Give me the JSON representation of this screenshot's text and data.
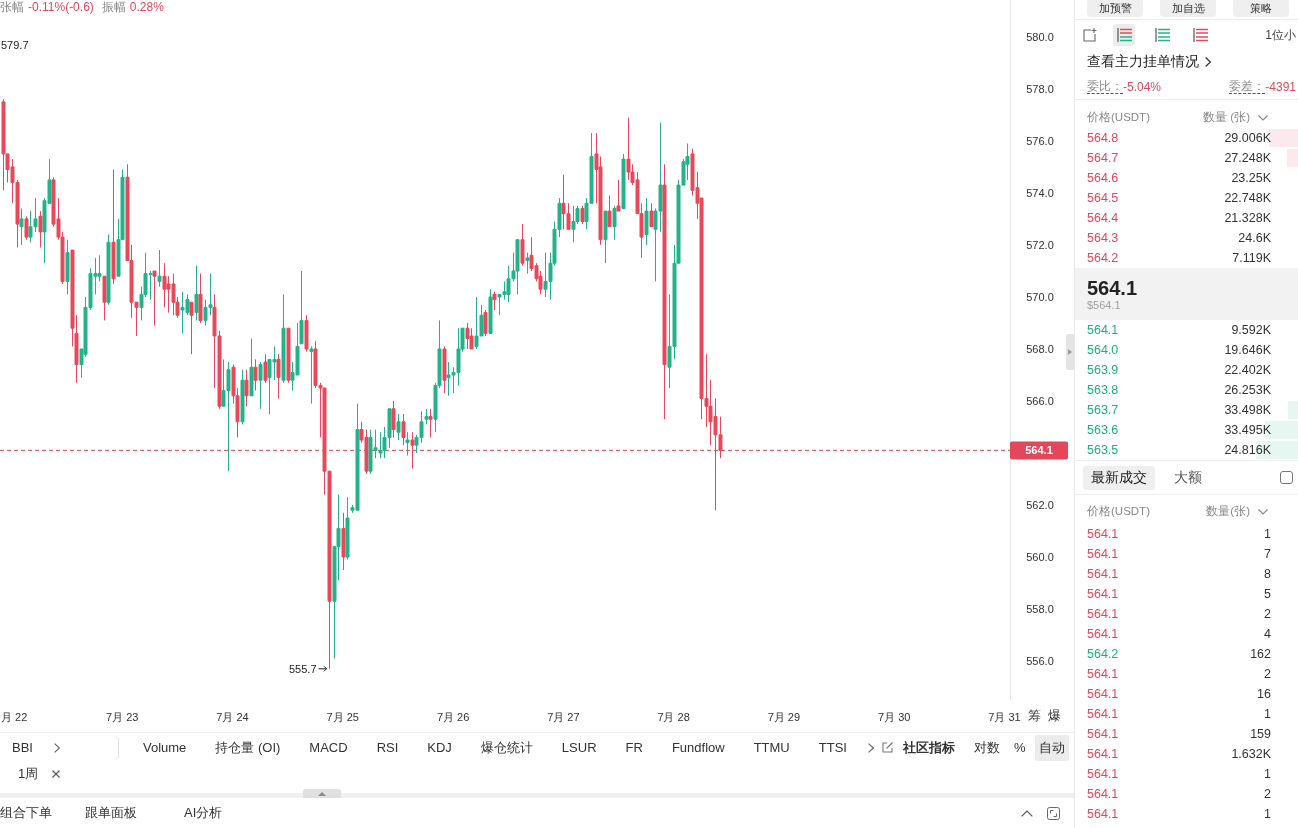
{
  "header": {
    "stats": [
      {
        "label": "张幅",
        "value": "-0.11%(-0.6)"
      },
      {
        "label": "振幅",
        "value": "0.28%"
      }
    ]
  },
  "chart": {
    "chart_data": [
      {
        "type": "candlestick",
        "x": [
          "--07-21T22:00",
          "--07-21T23:00",
          "--07-22T00:00",
          "--07-22T01:00",
          "--07-22T02:00",
          "--07-22T03:00",
          "--07-22T04:00",
          "--07-22T05:00",
          "--07-22T06:00",
          "--07-22T07:00",
          "--07-22T08:00",
          "--07-22T09:00",
          "--07-22T10:00",
          "--07-22T11:00",
          "--07-22T12:00",
          "--07-22T13:00",
          "--07-22T14:00",
          "--07-22T15:00",
          "--07-22T16:00",
          "--07-22T17:00",
          "--07-22T18:00",
          "--07-22T19:00",
          "--07-22T20:00",
          "--07-22T21:00",
          "--07-22T22:00",
          "--07-22T23:00",
          "--07-23T00:00",
          "--07-23T01:00",
          "--07-23T02:00",
          "--07-23T03:00",
          "--07-23T04:00",
          "--07-23T05:00",
          "--07-23T06:00",
          "--07-23T07:00",
          "--07-23T08:00",
          "--07-23T09:00",
          "--07-23T10:00",
          "--07-23T11:00",
          "--07-23T12:00",
          "--07-23T13:00",
          "--07-23T14:00",
          "--07-23T15:00",
          "--07-23T16:00",
          "--07-23T17:00",
          "--07-23T18:00",
          "--07-23T19:00",
          "--07-23T20:00",
          "--07-23T21:00",
          "--07-23T22:00",
          "--07-23T23:00",
          "--07-24T00:00",
          "--07-24T01:00",
          "--07-24T02:00",
          "--07-24T03:00",
          "--07-24T04:00",
          "--07-24T05:00",
          "--07-24T06:00",
          "--07-24T07:00",
          "--07-24T08:00",
          "--07-24T09:00",
          "--07-24T10:00",
          "--07-24T11:00",
          "--07-24T12:00",
          "--07-24T13:00",
          "--07-24T14:00",
          "--07-24T15:00",
          "--07-24T16:00",
          "--07-24T17:00",
          "--07-24T18:00",
          "--07-24T19:00",
          "--07-24T20:00",
          "--07-24T21:00",
          "--07-24T22:00",
          "--07-24T23:00",
          "--07-25T00:00",
          "--07-25T01:00",
          "--07-25T02:00",
          "--07-25T03:00",
          "--07-25T04:00",
          "--07-25T05:00",
          "--07-25T06:00",
          "--07-25T07:00",
          "--07-25T08:00",
          "--07-25T09:00",
          "--07-25T10:00",
          "--07-25T11:00",
          "--07-25T12:00",
          "--07-25T13:00",
          "--07-25T14:00",
          "--07-25T15:00",
          "--07-25T16:00",
          "--07-25T17:00",
          "--07-25T18:00",
          "--07-25T19:00",
          "--07-25T20:00",
          "--07-25T21:00",
          "--07-25T22:00",
          "--07-25T23:00",
          "--07-26T00:00",
          "--07-26T01:00",
          "--07-26T02:00",
          "--07-26T03:00",
          "--07-26T04:00",
          "--07-26T05:00",
          "--07-26T06:00",
          "--07-26T07:00",
          "--07-26T08:00",
          "--07-26T09:00",
          "--07-26T10:00",
          "--07-26T11:00",
          "--07-26T12:00",
          "--07-26T13:00",
          "--07-26T14:00",
          "--07-26T15:00",
          "--07-26T16:00",
          "--07-26T17:00",
          "--07-26T18:00",
          "--07-26T19:00",
          "--07-26T20:00",
          "--07-26T21:00",
          "--07-26T22:00",
          "--07-26T23:00",
          "--07-27T00:00",
          "--07-27T01:00",
          "--07-27T02:00",
          "--07-27T03:00",
          "--07-27T04:00",
          "--07-27T05:00",
          "--07-27T06:00",
          "--07-27T07:00",
          "--07-27T08:00",
          "--07-27T09:00",
          "--07-27T10:00",
          "--07-27T11:00",
          "--07-27T12:00",
          "--07-27T13:00",
          "--07-27T14:00",
          "--07-27T15:00",
          "--07-27T16:00",
          "--07-27T17:00",
          "--07-27T18:00",
          "--07-27T19:00",
          "--07-27T20:00",
          "--07-27T21:00",
          "--07-27T22:00",
          "--07-27T23:00",
          "--07-28T00:00",
          "--07-28T01:00",
          "--07-28T02:00",
          "--07-28T03:00",
          "--07-28T04:00",
          "--07-28T05:00",
          "--07-28T06:00",
          "--07-28T07:00",
          "--07-28T08:00",
          "--07-28T09:00",
          "--07-28T10:00"
        ],
        "ohlc": [
          [
            577.5,
            577.6,
            574.1,
            575.5
          ],
          [
            575.5,
            575.5,
            574.4,
            574.9
          ],
          [
            575.0,
            575.3,
            573.6,
            574.4
          ],
          [
            574.4,
            574.5,
            571.9,
            572.8
          ],
          [
            572.7,
            573.4,
            572.0,
            573.0
          ],
          [
            573.0,
            573.1,
            572.2,
            572.3
          ],
          [
            572.3,
            573.3,
            572.1,
            572.7
          ],
          [
            572.7,
            573.8,
            572.5,
            573.0
          ],
          [
            573.1,
            573.3,
            571.9,
            572.5
          ],
          [
            572.5,
            573.8,
            571.3,
            573.7
          ],
          [
            573.6,
            575.3,
            573.6,
            574.5
          ],
          [
            574.5,
            574.6,
            572.7,
            572.8
          ],
          [
            573.0,
            573.8,
            572.2,
            572.3
          ],
          [
            572.3,
            572.5,
            570.5,
            570.6
          ],
          [
            570.6,
            572.2,
            570.1,
            571.7
          ],
          [
            571.8,
            571.8,
            568.1,
            568.8
          ],
          [
            568.6,
            569.3,
            566.7,
            567.4
          ],
          [
            567.4,
            568.0,
            566.9,
            568.0
          ],
          [
            567.8,
            570.0,
            567.7,
            569.6
          ],
          [
            569.6,
            571.1,
            569.5,
            570.9
          ],
          [
            570.8,
            571.5,
            570.1,
            570.9
          ],
          [
            570.8,
            571.6,
            570.6,
            570.9
          ],
          [
            570.8,
            570.8,
            569.1,
            569.8
          ],
          [
            569.8,
            572.4,
            569.7,
            572.1
          ],
          [
            572.1,
            574.9,
            570.5,
            570.7
          ],
          [
            570.8,
            573.0,
            570.8,
            572.2
          ],
          [
            572.2,
            574.9,
            572.2,
            574.6
          ],
          [
            574.6,
            575.1,
            571.4,
            571.4
          ],
          [
            571.4,
            572.0,
            569.2,
            569.8
          ],
          [
            569.8,
            569.8,
            568.5,
            569.6
          ],
          [
            569.6,
            570.4,
            569.1,
            570.1
          ],
          [
            570.1,
            571.7,
            570.0,
            570.9
          ],
          [
            570.9,
            571.0,
            569.9,
            570.9
          ],
          [
            571.0,
            571.0,
            568.9,
            570.8
          ],
          [
            570.6,
            571.8,
            570.4,
            570.8
          ],
          [
            570.8,
            571.3,
            569.6,
            570.3
          ],
          [
            570.5,
            570.8,
            569.4,
            570.3
          ],
          [
            570.5,
            570.9,
            569.3,
            569.8
          ],
          [
            569.8,
            570.0,
            569.2,
            569.3
          ],
          [
            569.5,
            570.2,
            568.6,
            569.6
          ],
          [
            569.4,
            570.1,
            569.3,
            569.9
          ],
          [
            569.8,
            569.8,
            567.8,
            569.3
          ],
          [
            569.4,
            571.2,
            569.1,
            570.1
          ],
          [
            570.1,
            570.9,
            569.0,
            569.1
          ],
          [
            569.1,
            569.9,
            568.9,
            569.6
          ],
          [
            569.6,
            570.9,
            569.3,
            569.7
          ],
          [
            569.6,
            570.1,
            566.5,
            568.5
          ],
          [
            568.5,
            568.7,
            565.7,
            565.8
          ],
          [
            565.8,
            567.6,
            565.8,
            566.4
          ],
          [
            566.4,
            567.5,
            563.3,
            567.2
          ],
          [
            567.3,
            567.4,
            565.9,
            566.2
          ],
          [
            566.2,
            566.5,
            564.6,
            565.2
          ],
          [
            565.2,
            567.2,
            565.1,
            566.8
          ],
          [
            566.8,
            567.2,
            565.8,
            566.2
          ],
          [
            566.2,
            568.4,
            566.2,
            567.3
          ],
          [
            567.3,
            567.6,
            566.4,
            566.8
          ],
          [
            566.8,
            567.5,
            565.7,
            567.4
          ],
          [
            567.5,
            567.8,
            566.7,
            566.8
          ],
          [
            566.9,
            567.6,
            565.5,
            567.6
          ],
          [
            567.5,
            568.1,
            566.8,
            567.6
          ],
          [
            567.6,
            567.8,
            566.1,
            566.9
          ],
          [
            566.8,
            570.1,
            566.7,
            568.8
          ],
          [
            568.8,
            568.8,
            566.7,
            566.8
          ],
          [
            566.8,
            567.5,
            566.4,
            567.1
          ],
          [
            567.0,
            569.0,
            567.0,
            568.1
          ],
          [
            568.2,
            571.0,
            568.2,
            569.1
          ],
          [
            569.1,
            569.3,
            567.9,
            568.0
          ],
          [
            567.9,
            568.1,
            565.9,
            568.0
          ],
          [
            568.0,
            568.3,
            566.5,
            566.6
          ],
          [
            566.6,
            566.7,
            564.6,
            566.5
          ],
          [
            566.5,
            566.5,
            562.4,
            563.3
          ],
          [
            563.3,
            563.3,
            555.7,
            558.3
          ],
          [
            558.3,
            560.4,
            556.1,
            560.4
          ],
          [
            560.4,
            562.4,
            559.1,
            561.1
          ],
          [
            561.1,
            561.7,
            559.5,
            560.0
          ],
          [
            560.0,
            562.3,
            559.9,
            561.5
          ],
          [
            561.8,
            562.0,
            561.7,
            561.9
          ],
          [
            561.8,
            565.9,
            561.8,
            564.9
          ],
          [
            564.9,
            565.2,
            564.4,
            564.5
          ],
          [
            564.6,
            564.9,
            563.2,
            563.3
          ],
          [
            563.3,
            564.9,
            563.2,
            564.6
          ],
          [
            564.1,
            564.9,
            563.8,
            564.2
          ],
          [
            564.0,
            564.8,
            563.8,
            564.1
          ],
          [
            564.1,
            565.0,
            563.8,
            564.6
          ],
          [
            564.6,
            565.7,
            564.2,
            565.7
          ],
          [
            565.7,
            566.0,
            564.6,
            564.9
          ],
          [
            564.8,
            565.5,
            564.5,
            565.2
          ],
          [
            565.2,
            565.5,
            564.3,
            564.6
          ],
          [
            564.4,
            564.8,
            563.9,
            564.5
          ],
          [
            564.5,
            564.8,
            563.4,
            564.3
          ],
          [
            564.3,
            564.7,
            564.0,
            564.6
          ],
          [
            564.6,
            565.6,
            564.4,
            565.2
          ],
          [
            565.3,
            565.7,
            565.1,
            565.4
          ],
          [
            565.4,
            565.7,
            564.6,
            565.3
          ],
          [
            565.3,
            566.7,
            564.8,
            566.6
          ],
          [
            566.6,
            569.1,
            566.5,
            568.0
          ],
          [
            568.0,
            568.1,
            566.3,
            566.8
          ],
          [
            566.9,
            567.5,
            566.2,
            567.0
          ],
          [
            567.0,
            567.3,
            566.3,
            567.1
          ],
          [
            567.1,
            568.8,
            566.6,
            568.0
          ],
          [
            568.0,
            568.8,
            567.9,
            568.8
          ],
          [
            568.8,
            569.0,
            568.0,
            568.4
          ],
          [
            568.5,
            568.8,
            568.0,
            568.0
          ],
          [
            568.1,
            570.0,
            568.0,
            568.5
          ],
          [
            568.5,
            569.7,
            568.5,
            569.3
          ],
          [
            569.4,
            569.5,
            568.5,
            568.6
          ],
          [
            568.6,
            570.3,
            568.6,
            570.0
          ],
          [
            570.1,
            570.2,
            569.5,
            569.9
          ],
          [
            570.0,
            570.1,
            569.3,
            570.1
          ],
          [
            570.1,
            570.6,
            569.9,
            570.2
          ],
          [
            570.1,
            571.2,
            569.8,
            570.7
          ],
          [
            570.7,
            571.7,
            570.6,
            571.0
          ],
          [
            571.0,
            572.2,
            570.1,
            572.2
          ],
          [
            572.2,
            572.8,
            571.2,
            571.3
          ],
          [
            571.4,
            571.7,
            570.9,
            571.5
          ],
          [
            571.6,
            572.3,
            571.0,
            571.1
          ],
          [
            571.2,
            571.3,
            570.6,
            570.7
          ],
          [
            570.8,
            571.0,
            570.1,
            570.3
          ],
          [
            570.3,
            571.7,
            570.0,
            570.6
          ],
          [
            570.6,
            571.7,
            569.9,
            571.3
          ],
          [
            571.3,
            572.9,
            571.2,
            572.6
          ],
          [
            572.6,
            573.8,
            572.3,
            573.6
          ],
          [
            573.6,
            574.7,
            572.6,
            573.2
          ],
          [
            573.2,
            573.6,
            572.6,
            572.6
          ],
          [
            572.6,
            573.5,
            572.1,
            572.9
          ],
          [
            572.9,
            573.5,
            572.8,
            573.4
          ],
          [
            573.4,
            573.5,
            572.8,
            572.9
          ],
          [
            572.9,
            573.8,
            572.6,
            573.6
          ],
          [
            573.6,
            576.3,
            573.6,
            575.4
          ],
          [
            575.5,
            576.3,
            573.6,
            574.9
          ],
          [
            575.0,
            575.4,
            572.0,
            572.2
          ],
          [
            572.2,
            573.3,
            571.3,
            573.3
          ],
          [
            573.3,
            573.9,
            572.7,
            572.7
          ],
          [
            572.7,
            573.5,
            572.2,
            573.4
          ],
          [
            573.5,
            574.5,
            573.3,
            573.3
          ],
          [
            573.4,
            575.5,
            573.4,
            575.3
          ],
          [
            575.3,
            576.9,
            574.5,
            574.8
          ],
          [
            574.8,
            575.1,
            574.3,
            574.4
          ],
          [
            574.5,
            574.8,
            573.2,
            573.2
          ],
          [
            573.2,
            573.6,
            571.5,
            572.3
          ],
          [
            572.4,
            573.8,
            572.0,
            573.3
          ],
          [
            573.3,
            573.6,
            572.7,
            572.7
          ],
          [
            572.6,
            573.4,
            570.6,
            573.3
          ],
          [
            573.3,
            576.7,
            572.5,
            574.3
          ],
          [
            574.3,
            575.1,
            565.3,
            567.4
          ],
          [
            567.3,
            570.1,
            566.5,
            568.1
          ],
          [
            568.1,
            572.0,
            567.6,
            571.3
          ],
          [
            571.3,
            574.5,
            571.3,
            574.3
          ],
          [
            574.3,
            575.3,
            574.3,
            575.2
          ],
          [
            575.1,
            575.9,
            574.5,
            575.4
          ],
          [
            575.5,
            575.7,
            573.9,
            574.1
          ],
          [
            574.2,
            574.8,
            573.0,
            573.6
          ],
          [
            573.8,
            573.8,
            565.3,
            566.1
          ],
          [
            566.1,
            567.8,
            565.0,
            565.8
          ],
          [
            565.8,
            566.8,
            564.3,
            565.2
          ],
          [
            565.4,
            566.1,
            561.8,
            564.7
          ],
          [
            564.7,
            565.4,
            563.8,
            564.1
          ]
        ],
        "xlim": [
          "--07-21T21:24",
          "--07-31T01:12"
        ],
        "ylim": [
          554.5,
          581.42
        ],
        "xticks": [
          {
            "value": "--07-22T00:00",
            "label": "月 22"
          },
          {
            "value": "--07-23T00:00",
            "label": "7月 23"
          },
          {
            "value": "--07-24T00:00",
            "label": "7月 24"
          },
          {
            "value": "--07-25T00:00",
            "label": "7月 25"
          },
          {
            "value": "--07-26T00:00",
            "label": "7月 26"
          },
          {
            "value": "--07-27T00:00",
            "label": "7月 27"
          },
          {
            "value": "--07-28T00:00",
            "label": "7月 28"
          },
          {
            "value": "--07-29T00:00",
            "label": "7月 29"
          },
          {
            "value": "--07-30T00:00",
            "label": "7月 30"
          },
          {
            "value": "--07-31T00:00",
            "label": "7月 31"
          }
        ],
        "yticks": [
          {
            "value": 556,
            "label": "556.0"
          },
          {
            "value": 558,
            "label": "558.0"
          },
          {
            "value": 560,
            "label": "560.0"
          },
          {
            "value": 562,
            "label": "562.0"
          },
          {
            "value": 566,
            "label": "566.0"
          },
          {
            "value": 568,
            "label": "568.0"
          },
          {
            "value": 570,
            "label": "570.0"
          },
          {
            "value": 572,
            "label": "572.0"
          },
          {
            "value": 574,
            "label": "574.0"
          },
          {
            "value": 576,
            "label": "576.0"
          },
          {
            "value": 578,
            "label": "578.0"
          },
          {
            "value": 580,
            "label": "580.0"
          }
        ],
        "ref_lines": [
          {
            "axis": "y",
            "value": 564.1,
            "label": "564.1",
            "color": "#e2475a",
            "line_style": "dashed"
          }
        ],
        "annotations": [
          "579.7",
          "555.7"
        ]
      }
    ],
    "toggles": [
      "筹",
      "爆"
    ]
  },
  "indicator_bar": {
    "main_indicator": "BBI",
    "tabs": [
      "Volume",
      "持仓量 (OI)",
      "MACD",
      "RSI",
      "KDJ",
      "爆仓统计",
      "LSUR",
      "FR",
      "Fundflow",
      "TTMU",
      "TTSI"
    ],
    "community": "社区指标",
    "scale_options": [
      {
        "label": "对数",
        "selected": false
      },
      {
        "label": "%",
        "selected": false
      },
      {
        "label": "自动",
        "selected": true
      }
    ]
  },
  "timeframe_tags": [
    {
      "label": "1周"
    }
  ],
  "bottom_tabs": [
    "组合下单",
    "跟单面板",
    "AI分析"
  ],
  "side_panel": {
    "actions": [
      "加预警",
      "加自选",
      "策略"
    ],
    "book_views": [
      {
        "kind": "both",
        "selected": true
      },
      {
        "kind": "bids",
        "selected": false
      },
      {
        "kind": "asks",
        "selected": false
      }
    ],
    "precision": "1位小",
    "main_orders_link": "查看主力挂单情况",
    "stats": [
      {
        "label": "委比：",
        "value": "-5.04%"
      },
      {
        "label": "委差：",
        "value": "-4391"
      }
    ],
    "order_book": {
      "columns": [
        "价格(USDT)",
        "数量 (张)"
      ],
      "asks": [
        {
          "price": "564.8",
          "amount": "29.006K",
          "level": 0.13
        },
        {
          "price": "564.7",
          "amount": "27.248K",
          "level": 0.05
        },
        {
          "price": "564.6",
          "amount": "23.25K"
        },
        {
          "price": "564.5",
          "amount": "22.748K"
        },
        {
          "price": "564.4",
          "amount": "21.328K"
        },
        {
          "price": "564.3",
          "amount": "24.6K"
        },
        {
          "price": "564.2",
          "amount": "7.119K"
        }
      ],
      "last_price": "564.1",
      "last_price_usd": "$564.1",
      "bids": [
        {
          "price": "564.1",
          "amount": "9.592K"
        },
        {
          "price": "564.0",
          "amount": "19.646K"
        },
        {
          "price": "563.9",
          "amount": "22.402K"
        },
        {
          "price": "563.8",
          "amount": "26.253K"
        },
        {
          "price": "563.7",
          "amount": "33.498K",
          "level": 0.045
        },
        {
          "price": "563.6",
          "amount": "33.495K",
          "level": 0.15
        },
        {
          "price": "563.5",
          "amount": "24.816K",
          "level": 0.19
        }
      ]
    },
    "trades": {
      "tabs": [
        {
          "label": "最新成交",
          "selected": true
        },
        {
          "label": "大额",
          "selected": false
        }
      ],
      "filter_checked": false,
      "columns": [
        "价格(USDT)",
        "数量(张)"
      ],
      "rows": [
        {
          "price": "564.1",
          "amount": "1",
          "color": "#e2475a"
        },
        {
          "price": "564.1",
          "amount": "7",
          "color": "#e2475a"
        },
        {
          "price": "564.1",
          "amount": "8",
          "color": "#e2475a"
        },
        {
          "price": "564.1",
          "amount": "5",
          "color": "#e2475a"
        },
        {
          "price": "564.1",
          "amount": "2",
          "color": "#e2475a"
        },
        {
          "price": "564.1",
          "amount": "4",
          "color": "#e2475a"
        },
        {
          "price": "564.2",
          "amount": "162",
          "color": "#1fae83"
        },
        {
          "price": "564.1",
          "amount": "2",
          "color": "#e2475a"
        },
        {
          "price": "564.1",
          "amount": "16",
          "color": "#e2475a"
        },
        {
          "price": "564.1",
          "amount": "1",
          "color": "#e2475a"
        },
        {
          "price": "564.1",
          "amount": "159",
          "color": "#e2475a"
        },
        {
          "price": "564.1",
          "amount": "1.632K",
          "color": "#e2475a"
        },
        {
          "price": "564.1",
          "amount": "1",
          "color": "#e2475a"
        },
        {
          "price": "564.1",
          "amount": "2",
          "color": "#e2475a"
        },
        {
          "price": "564.1",
          "amount": "1",
          "color": "#e2475a"
        }
      ]
    }
  }
}
